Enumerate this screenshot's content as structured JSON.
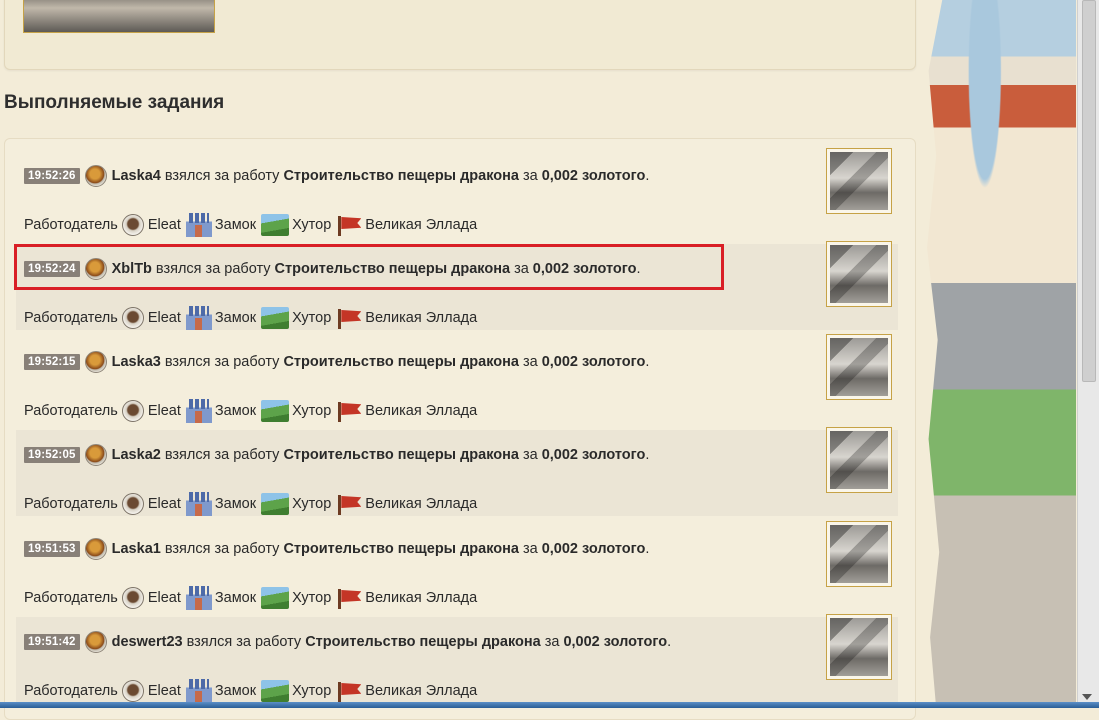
{
  "section": {
    "title": "Выполняемые задания"
  },
  "labels": {
    "took_job": "взялся за работу",
    "for": "за",
    "period": ".",
    "employer": "Работодатель"
  },
  "rows": [
    {
      "time": "19:52:26",
      "user": "Laska4",
      "task": "Строительство пещеры дракона",
      "gold": "0,002 золотого",
      "employer_name": "Eleat",
      "castle": "Замок",
      "farm": "Хутор",
      "realm": "Великая Эллада"
    },
    {
      "time": "19:52:24",
      "user": "XblTb",
      "task": "Строительство пещеры дракона",
      "gold": "0,002 золотого",
      "employer_name": "Eleat",
      "castle": "Замок",
      "farm": "Хутор",
      "realm": "Великая Эллада"
    },
    {
      "time": "19:52:15",
      "user": "Laska3",
      "task": "Строительство пещеры дракона",
      "gold": "0,002 золотого",
      "employer_name": "Eleat",
      "castle": "Замок",
      "farm": "Хутор",
      "realm": "Великая Эллада"
    },
    {
      "time": "19:52:05",
      "user": "Laska2",
      "task": "Строительство пещеры дракона",
      "gold": "0,002 золотого",
      "employer_name": "Eleat",
      "castle": "Замок",
      "farm": "Хутор",
      "realm": "Великая Эллада"
    },
    {
      "time": "19:51:53",
      "user": "Laska1",
      "task": "Строительство пещеры дракона",
      "gold": "0,002 золотого",
      "employer_name": "Eleat",
      "castle": "Замок",
      "farm": "Хутор",
      "realm": "Великая Эллада"
    },
    {
      "time": "19:51:42",
      "user": "deswert23",
      "task": "Строительство пещеры дракона",
      "gold": "0,002 золотого",
      "employer_name": "Eleat",
      "castle": "Замок",
      "farm": "Хутор",
      "realm": "Великая Эллада"
    }
  ],
  "icons": {
    "user_avatar": "player-avatar-icon",
    "employer_avatar": "employer-portrait-icon",
    "castle": "castle-icon",
    "farm": "farm-icon",
    "realm": "flag-icon",
    "thumbnail": "building-thumbnail"
  },
  "colors": {
    "highlight": "#d91f26",
    "time_badge": "#888078",
    "thumb_border": "#c6a246"
  }
}
